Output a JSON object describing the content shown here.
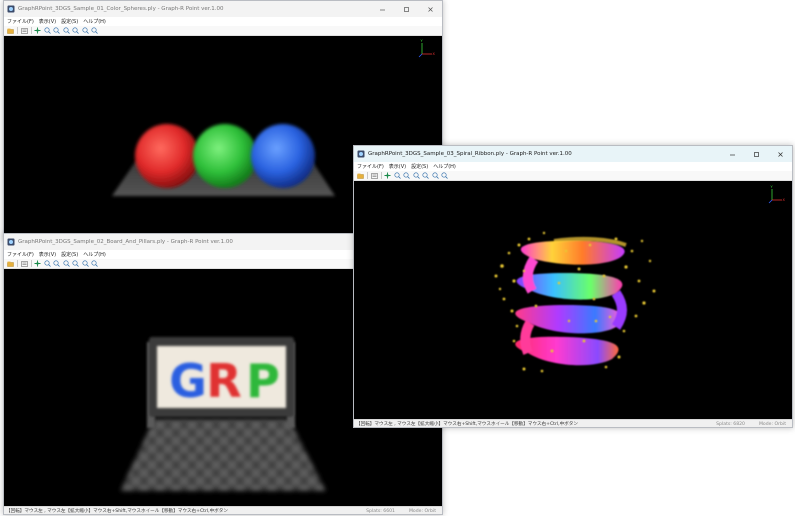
{
  "menus": [
    "ファイル(F)",
    "表示(V)",
    "設定(S)",
    "ヘルプ(H)"
  ],
  "toolbar_icons": [
    "open-icon",
    "list-icon",
    "move-icon",
    "zoom-in-icon",
    "zoom-out-icon",
    "zoom-fit-icon",
    "zoom-region-icon",
    "zoom-reset-icon",
    "zoom-window-icon"
  ],
  "axis_labels": {
    "y": "Y",
    "x": "X"
  },
  "status_hint": "【回転】マウス左 , マウス左【拡大縮小】マウス右+Shift,マウスホイール【移動】マウス右+Ctrl,中ボタン",
  "windows": {
    "w1": {
      "title": "GraphRPoint_3DGS_Sample_01_Color_Spheres.ply - Graph-R Point ver.1.00"
    },
    "w2": {
      "title": "GraphRPoint_3DGS_Sample_02_Board_And_Pillars.ply - Graph-R Point ver.1.00",
      "splats": "Splats: 6601",
      "mode": "Mode: Orbit",
      "board_text": [
        "G",
        "R",
        "P"
      ]
    },
    "w3": {
      "title": "GraphRPoint_3DGS_Sample_03_Spiral_Ribbon.ply - Graph-R Point ver.1.00",
      "splats": "Splats: 6820",
      "mode": "Mode: Orbit"
    }
  },
  "colors": {
    "red": "#e03030",
    "green": "#32c040",
    "blue": "#2860e0",
    "board_bg": "#f0ebe0",
    "gold": "#e8c830"
  }
}
